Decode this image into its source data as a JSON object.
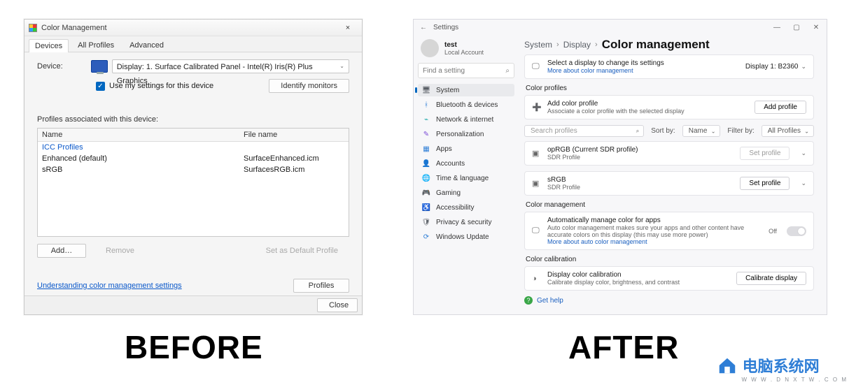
{
  "labels": {
    "before": "BEFORE",
    "after": "AFTER"
  },
  "left": {
    "title": "Color Management",
    "close_glyph": "×",
    "tabs": [
      "Devices",
      "All Profiles",
      "Advanced"
    ],
    "active_tab": 0,
    "device_label": "Device:",
    "device_select": "Display: 1. Surface Calibrated Panel - Intel(R) Iris(R) Plus Graphics",
    "chev": "⌄",
    "use_settings_label": "Use my settings for this device",
    "identify_btn": "Identify monitors",
    "profiles_assoc_label": "Profiles associated with this device:",
    "cols": {
      "name": "Name",
      "file": "File name"
    },
    "group": "ICC Profiles",
    "rows": [
      {
        "name": "Enhanced (default)",
        "file": "SurfaceEnhanced.icm"
      },
      {
        "name": "sRGB",
        "file": "SurfacesRGB.icm"
      }
    ],
    "buttons": {
      "add": "Add…",
      "remove": "Remove",
      "set_default": "Set as Default Profile",
      "profiles": "Profiles",
      "close": "Close"
    },
    "help_link": "Understanding color management settings"
  },
  "right": {
    "titlebar": {
      "back": "←",
      "title": "Settings",
      "min": "—",
      "max": "▢",
      "close": "✕"
    },
    "user": {
      "name": "test",
      "subtitle": "Local Account"
    },
    "search_placeholder": "Find a setting",
    "search_icon": "⌕",
    "nav": [
      {
        "icon": "🖥",
        "label": "System",
        "cls": "c-gray",
        "active": true
      },
      {
        "icon": "ᚼ",
        "label": "Bluetooth & devices",
        "cls": "c-blue"
      },
      {
        "icon": "⌁",
        "label": "Network & internet",
        "cls": "c-teal"
      },
      {
        "icon": "✎",
        "label": "Personalization",
        "cls": "c-purple"
      },
      {
        "icon": "▦",
        "label": "Apps",
        "cls": "c-blue"
      },
      {
        "icon": "👤",
        "label": "Accounts",
        "cls": "c-orange"
      },
      {
        "icon": "🌐",
        "label": "Time & language",
        "cls": "c-teal"
      },
      {
        "icon": "🎮",
        "label": "Gaming",
        "cls": "c-gray"
      },
      {
        "icon": "♿",
        "label": "Accessibility",
        "cls": "c-blue"
      },
      {
        "icon": "🛡",
        "label": "Privacy & security",
        "cls": "c-gray"
      },
      {
        "icon": "⟳",
        "label": "Windows Update",
        "cls": "c-blue"
      }
    ],
    "breadcrumb": {
      "a": "System",
      "b": "Display",
      "c": "Color management",
      "sep": "›"
    },
    "display_select_header": {
      "line1": "Select a display to change its settings",
      "link": "More about color management",
      "display_value": "Display 1: B2360",
      "chev": "⌄"
    },
    "color_profiles": {
      "title": "Color profiles",
      "add_title": "Add color profile",
      "add_sub": "Associate a color profile with the selected display",
      "add_btn": "Add profile",
      "search_placeholder": "Search profiles",
      "search_icon": "⌕",
      "sort_label": "Sort by:",
      "sort_value": "Name",
      "filter_label": "Filter by:",
      "filter_value": "All Profiles",
      "items": [
        {
          "name": "opRGB (Current SDR profile)",
          "sub": "SDR Profile",
          "btn": "Set profile",
          "chev": "⌄"
        },
        {
          "name": "sRGB",
          "sub": "SDR Profile",
          "btn": "Set profile",
          "chev": "⌄"
        }
      ]
    },
    "color_mgmt": {
      "title": "Color management",
      "row_title": "Automatically manage color for apps",
      "row_sub": "Auto color management makes sure your apps and other content have accurate colors on this display (this may use more power)",
      "row_link": "More about auto color management",
      "toggle_label": "Off"
    },
    "color_calib": {
      "title": "Color calibration",
      "row_title": "Display color calibration",
      "row_sub": "Calibrate display color, brightness, and contrast",
      "btn": "Calibrate display"
    },
    "help": {
      "icon": "?",
      "label": "Get help"
    }
  },
  "watermark": {
    "cn": "电脑系统网",
    "en": "W W W . D N X T W . C O M"
  }
}
